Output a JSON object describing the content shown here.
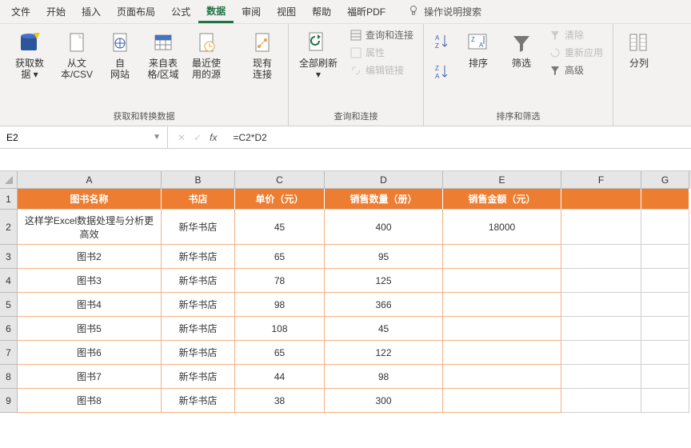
{
  "menu": {
    "tabs": [
      "文件",
      "开始",
      "插入",
      "页面布局",
      "公式",
      "数据",
      "审阅",
      "视图",
      "帮助",
      "福昕PDF"
    ],
    "active_index": 5,
    "tell_me": "操作说明搜索"
  },
  "ribbon": {
    "group1": {
      "label": "获取和转换数据",
      "btns": [
        "获取数\n据 ▾",
        "从文\n本/CSV",
        "自\n网站",
        "来自表\n格/区域",
        "最近使\n用的源",
        "现有\n连接"
      ]
    },
    "group2": {
      "label": "查询和连接",
      "refresh": "全部刷新\n▾",
      "items": [
        "查询和连接",
        "属性",
        "编辑链接"
      ]
    },
    "group3": {
      "label": "排序和筛选",
      "sort": "排序",
      "filter": "筛选",
      "side": [
        "清除",
        "重新应用",
        "高级"
      ]
    },
    "group4": {
      "label": "",
      "btn": "分列"
    }
  },
  "formula": {
    "name_box": "E2",
    "value": "=C2*D2"
  },
  "columns": [
    "A",
    "B",
    "C",
    "D",
    "E",
    "F",
    "G"
  ],
  "table": {
    "headers": [
      "图书名称",
      "书店",
      "单价（元）",
      "销售数量（册）",
      "销售金额（元）"
    ],
    "rows": [
      [
        "这样学Excel数据处理与分析更高效",
        "新华书店",
        "45",
        "400",
        "18000"
      ],
      [
        "图书2",
        "新华书店",
        "65",
        "95",
        ""
      ],
      [
        "图书3",
        "新华书店",
        "78",
        "125",
        ""
      ],
      [
        "图书4",
        "新华书店",
        "98",
        "366",
        ""
      ],
      [
        "图书5",
        "新华书店",
        "108",
        "45",
        ""
      ],
      [
        "图书6",
        "新华书店",
        "65",
        "122",
        ""
      ],
      [
        "图书7",
        "新华书店",
        "44",
        "98",
        ""
      ],
      [
        "图书8",
        "新华书店",
        "38",
        "300",
        ""
      ]
    ]
  }
}
